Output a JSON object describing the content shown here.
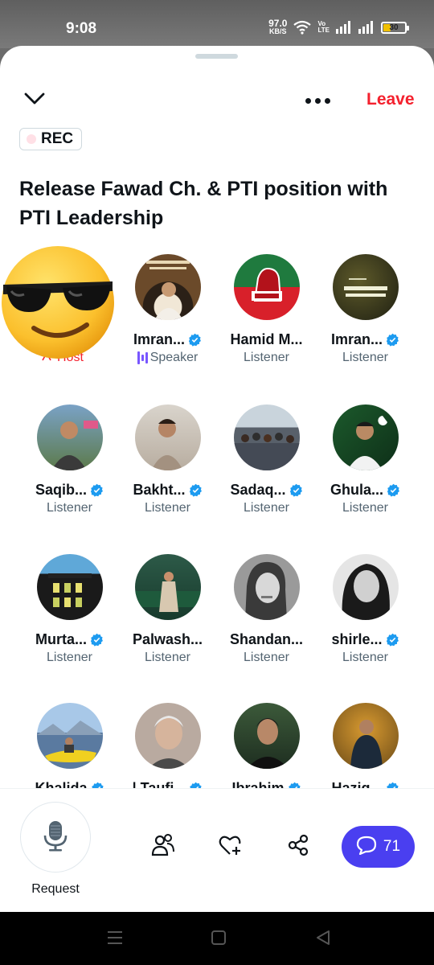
{
  "status": {
    "time": "9:08",
    "net_speed_value": "97.0",
    "net_speed_unit": "KB/S",
    "volte_top": "Vo",
    "volte_bottom": "LTE",
    "battery": "30"
  },
  "header": {
    "leave_label": "Leave",
    "rec_label": "REC"
  },
  "space": {
    "title": "Release Fawad Ch. & PTI position with PTI Leadership"
  },
  "participants": [
    {
      "name": "",
      "role": "Host",
      "verified": false,
      "avatar": "host-avatar"
    },
    {
      "name": "Imran...",
      "role": "Speaker",
      "verified": true,
      "avatar": "imran-khan-avatar"
    },
    {
      "name": "Hamid M...",
      "role": "Listener",
      "verified": false,
      "avatar": "pti-fist-logo-avatar"
    },
    {
      "name": "Imran...",
      "role": "Listener",
      "verified": true,
      "avatar": "allah-is-the-best-of-planners-avatar"
    },
    {
      "name": "Saqib...",
      "role": "Listener",
      "verified": true,
      "avatar": "man-in-suit-avatar"
    },
    {
      "name": "Bakht...",
      "role": "Listener",
      "verified": true,
      "avatar": "man-portrait-avatar"
    },
    {
      "name": "Sadaq...",
      "role": "Listener",
      "verified": true,
      "avatar": "crowd-avatar"
    },
    {
      "name": "Ghula...",
      "role": "Listener",
      "verified": true,
      "avatar": "man-with-flag-avatar"
    },
    {
      "name": "Murta...",
      "role": "Listener",
      "verified": true,
      "avatar": "building-avatar"
    },
    {
      "name": "Palwash...",
      "role": "Listener",
      "verified": false,
      "avatar": "woman-green-room-avatar"
    },
    {
      "name": "Shandan...",
      "role": "Listener",
      "verified": false,
      "avatar": "woman-bw-avatar"
    },
    {
      "name": "shirle...",
      "role": "Listener",
      "verified": true,
      "avatar": "girl-bw-avatar"
    },
    {
      "name": "Khalida",
      "role": "",
      "verified": true,
      "avatar": "kayak-avatar"
    },
    {
      "name": "| Taufi...",
      "role": "",
      "verified": true,
      "avatar": "older-man-avatar"
    },
    {
      "name": "Ibrahim",
      "role": "",
      "verified": true,
      "avatar": "young-man-avatar"
    },
    {
      "name": "Haziq...",
      "role": "",
      "verified": true,
      "avatar": "man-autumn-avatar"
    }
  ],
  "bottom_bar": {
    "request_label": "Request",
    "comment_count": "71"
  },
  "colors": {
    "leave": "#f4212e",
    "verified": "#1d9bf0",
    "speaker": "#7856ff",
    "comment_button": "#4a3ff0"
  }
}
